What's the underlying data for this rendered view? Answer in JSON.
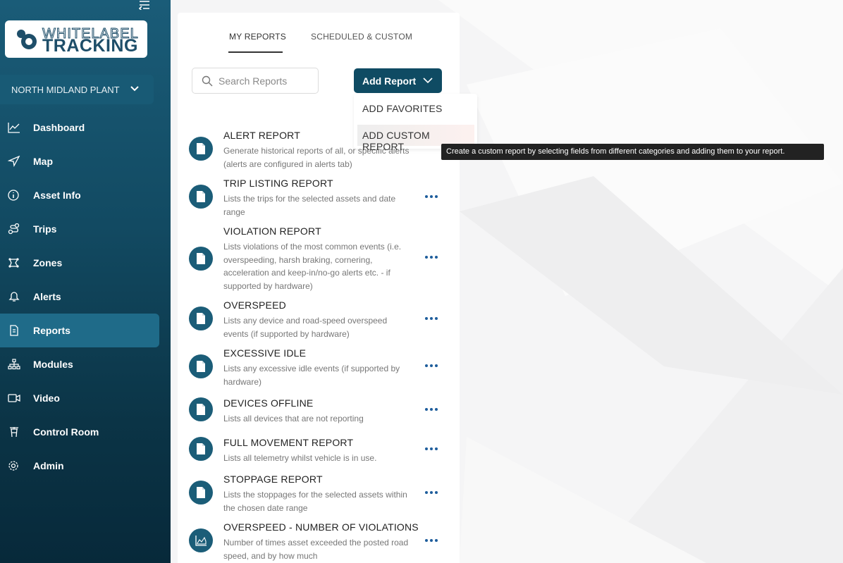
{
  "sidebar": {
    "logo": {
      "top": "WHITELABEL",
      "bottom": "TRACKING"
    },
    "org": "NORTH MIDLAND PLANT L",
    "items": [
      {
        "label": "Dashboard",
        "icon": "chart-line-icon"
      },
      {
        "label": "Map",
        "icon": "navigation-arrow-icon"
      },
      {
        "label": "Asset Info",
        "icon": "info-circle-icon"
      },
      {
        "label": "Trips",
        "icon": "route-icon"
      },
      {
        "label": "Zones",
        "icon": "zone-polygon-icon"
      },
      {
        "label": "Alerts",
        "icon": "bell-icon"
      },
      {
        "label": "Reports",
        "icon": "document-icon",
        "active": true
      },
      {
        "label": "Modules",
        "icon": "hierarchy-icon"
      },
      {
        "label": "Video",
        "icon": "video-camera-icon"
      },
      {
        "label": "Control Room",
        "icon": "tower-icon"
      },
      {
        "label": "Admin",
        "icon": "gear-icon"
      }
    ]
  },
  "tabs": {
    "my": "MY REPORTS",
    "scheduled": "SCHEDULED & CUSTOM"
  },
  "search": {
    "placeholder": "Search Reports"
  },
  "add_button": {
    "label": "Add Report"
  },
  "dropdown": {
    "favorites": "ADD FAVORITES",
    "custom": "ADD CUSTOM REPORT"
  },
  "tooltip": "Create a custom report by selecting fields from different categories and adding them to your report.",
  "reports": [
    {
      "title": "ALERT REPORT",
      "desc": "Generate historical reports of all, or specific alerts (alerts are configured in alerts tab)"
    },
    {
      "title": "TRIP LISTING REPORT",
      "desc": "Lists the trips for the selected assets and date range"
    },
    {
      "title": "VIOLATION REPORT",
      "desc": "Lists violations of the most common events (i.e. overspeeding, harsh braking, cornering, acceleration and keep-in/no-go alerts etc. - if supported by hardware)"
    },
    {
      "title": "OVERSPEED",
      "desc": "Lists any device and road-speed overspeed events (if supported by hardware)"
    },
    {
      "title": "EXCESSIVE IDLE",
      "desc": "Lists any excessive idle events (if supported by hardware)"
    },
    {
      "title": "DEVICES OFFLINE",
      "desc": "Lists all devices that are not reporting"
    },
    {
      "title": "FULL MOVEMENT REPORT",
      "desc": "Lists all telemetry whilst vehicle is in use."
    },
    {
      "title": "STOPPAGE REPORT",
      "desc": "Lists the stoppages for the selected assets within the chosen date range"
    },
    {
      "title": "OVERSPEED - NUMBER OF VIOLATIONS",
      "desc": "Number of times asset exceeded the posted road speed, and by how much"
    }
  ],
  "colors": {
    "sidebar": "#124a62",
    "accent": "#0f4b63",
    "active": "#1f6b89",
    "dots": "#1e5d9c"
  }
}
